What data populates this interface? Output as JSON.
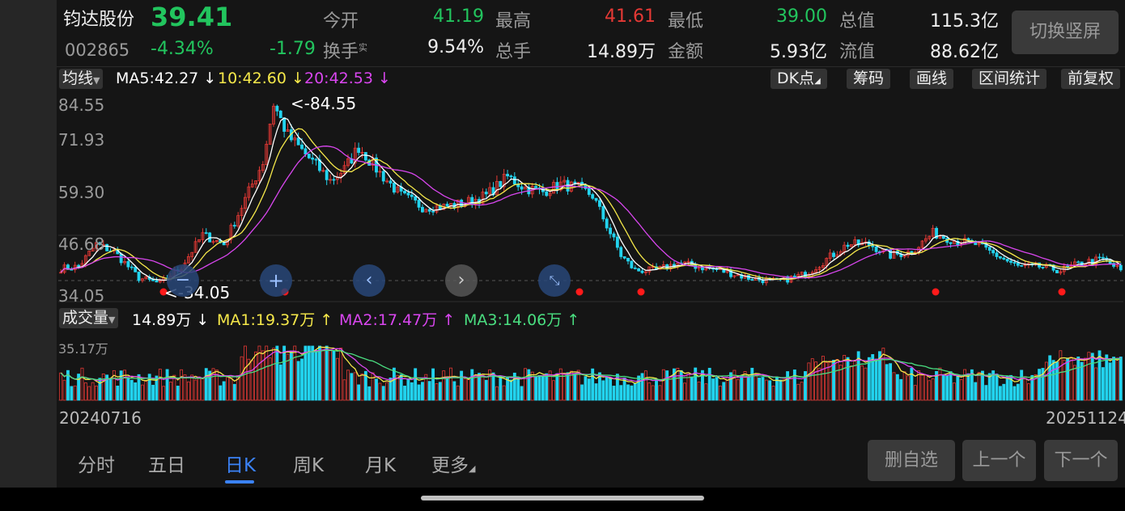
{
  "header": {
    "name": "钧达股份",
    "price": "39.41",
    "code": "002865",
    "change_pct": "-4.34%",
    "change": "-1.79",
    "fields": [
      {
        "label": "今开",
        "value": "41.19",
        "color": "green"
      },
      {
        "label": "最高",
        "value": "41.61",
        "color": "red"
      },
      {
        "label": "最低",
        "value": "39.00",
        "color": "green"
      },
      {
        "label": "总值",
        "value": "115.3亿",
        "color": "white"
      },
      {
        "label": "换手",
        "sup": "实",
        "value": "9.54%",
        "color": "white"
      },
      {
        "label": "总手",
        "value": "14.89万",
        "color": "white"
      },
      {
        "label": "金额",
        "value": "5.93亿",
        "color": "white"
      },
      {
        "label": "流值",
        "value": "88.62亿",
        "color": "white"
      }
    ],
    "switch_label": "切换竖屏"
  },
  "ma_bar": {
    "toggle": "均线",
    "ma5": "MA5:42.27 ↓",
    "ma10": "10:42.60 ↓",
    "ma20": "20:42.53 ↓",
    "tools": [
      "DK点",
      "筹码",
      "画线",
      "区间统计",
      "前复权"
    ]
  },
  "price_chart": {
    "y_labels": [
      "84.55",
      "71.93",
      "59.30",
      "46.68",
      "34.05"
    ],
    "max_label": "<-84.55",
    "min_label": "<-34.05",
    "controls": [
      "zoom-out-icon",
      "zoom-in-icon",
      "scroll-left-icon",
      "scroll-right-icon",
      "collapse-icon"
    ]
  },
  "volume_bar": {
    "toggle": "成交量",
    "current": "14.89万 ↓",
    "ma1": "MA1:19.37万 ↑",
    "ma2": "MA2:17.47万 ↑",
    "ma3": "MA3:14.06万 ↑",
    "y_max": "35.17万"
  },
  "dates": {
    "start": "20240716",
    "end": "20251124"
  },
  "tabs": [
    "分时",
    "五日",
    "日K",
    "周K",
    "月K",
    "更多"
  ],
  "active_tab": "日K",
  "actions": [
    "删自选",
    "上一个",
    "下一个"
  ],
  "colors": {
    "up": "#e53935",
    "down": "#22d3ee",
    "ma5": "#ffffff",
    "ma10": "#f5e84a",
    "ma20": "#d946ef",
    "vol_ma1": "#f5e84a",
    "vol_ma2": "#d946ef",
    "vol_ma3": "#4ade80"
  },
  "chart_data": {
    "type": "candlestick",
    "x_range": [
      "20240716",
      "20251124"
    ],
    "y_range": [
      34.05,
      84.55
    ],
    "y_ticks": [
      84.55,
      71.93,
      59.3,
      46.68,
      34.05
    ],
    "anchors": [
      [
        0,
        40.5
      ],
      [
        5,
        41
      ],
      [
        10,
        47
      ],
      [
        15,
        45
      ],
      [
        22,
        38
      ],
      [
        28,
        36.5
      ],
      [
        34,
        41
      ],
      [
        40,
        49.5
      ],
      [
        46,
        47
      ],
      [
        53,
        61
      ],
      [
        57,
        69
      ],
      [
        60,
        84.55
      ],
      [
        64,
        76
      ],
      [
        70,
        70
      ],
      [
        76,
        64
      ],
      [
        80,
        67
      ],
      [
        84,
        73
      ],
      [
        90,
        66
      ],
      [
        96,
        60
      ],
      [
        102,
        57
      ],
      [
        108,
        57
      ],
      [
        114,
        58
      ],
      [
        120,
        60
      ],
      [
        126,
        65
      ],
      [
        131,
        62
      ],
      [
        136,
        61
      ],
      [
        141,
        63
      ],
      [
        146,
        62
      ],
      [
        150,
        60
      ],
      [
        154,
        52
      ],
      [
        158,
        44
      ],
      [
        162,
        40
      ],
      [
        168,
        40
      ],
      [
        174,
        42
      ],
      [
        180,
        41
      ],
      [
        186,
        40
      ],
      [
        194,
        38
      ],
      [
        202,
        37
      ],
      [
        210,
        39
      ],
      [
        216,
        43
      ],
      [
        222,
        47
      ],
      [
        228,
        47
      ],
      [
        234,
        44
      ],
      [
        240,
        45
      ],
      [
        246,
        50
      ],
      [
        252,
        48
      ],
      [
        258,
        47
      ],
      [
        264,
        44
      ],
      [
        270,
        41
      ],
      [
        276,
        41
      ],
      [
        282,
        40
      ],
      [
        288,
        42
      ],
      [
        294,
        43
      ],
      [
        299,
        40
      ]
    ],
    "volume_y_max": "35.17万"
  }
}
